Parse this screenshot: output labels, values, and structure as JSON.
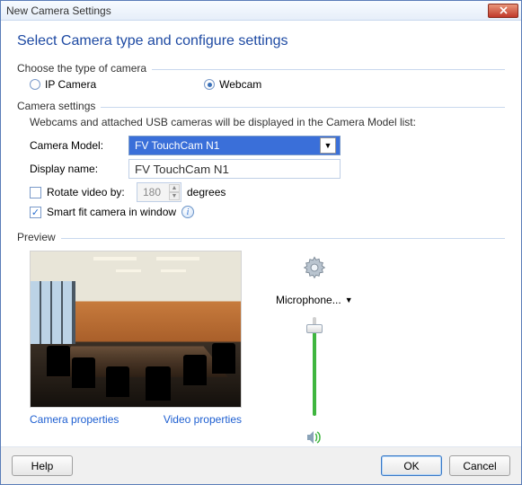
{
  "window": {
    "title": "New Camera Settings"
  },
  "heading": "Select Camera type and configure settings",
  "groups": {
    "type": {
      "label": "Choose the type of camera",
      "ip_label": "IP Camera",
      "webcam_label": "Webcam",
      "selected": "webcam"
    },
    "settings": {
      "label": "Camera settings",
      "hint": "Webcams and attached USB cameras will be displayed in the Camera Model list:",
      "model_label": "Camera Model:",
      "model_value": "FV TouchCam N1",
      "display_label": "Display name:",
      "display_value": "FV TouchCam N1",
      "rotate_label": "Rotate video by:",
      "rotate_value": "180",
      "rotate_unit": "degrees",
      "rotate_checked": false,
      "smartfit_label": "Smart fit camera in window",
      "smartfit_checked": true
    },
    "preview": {
      "label": "Preview",
      "camera_props_link": "Camera properties",
      "video_props_link": "Video properties",
      "mic_label": "Microphone..."
    }
  },
  "footer": {
    "help": "Help",
    "ok": "OK",
    "cancel": "Cancel"
  },
  "colors": {
    "accent": "#1e4aa3",
    "select_bg": "#3a6fd9"
  }
}
